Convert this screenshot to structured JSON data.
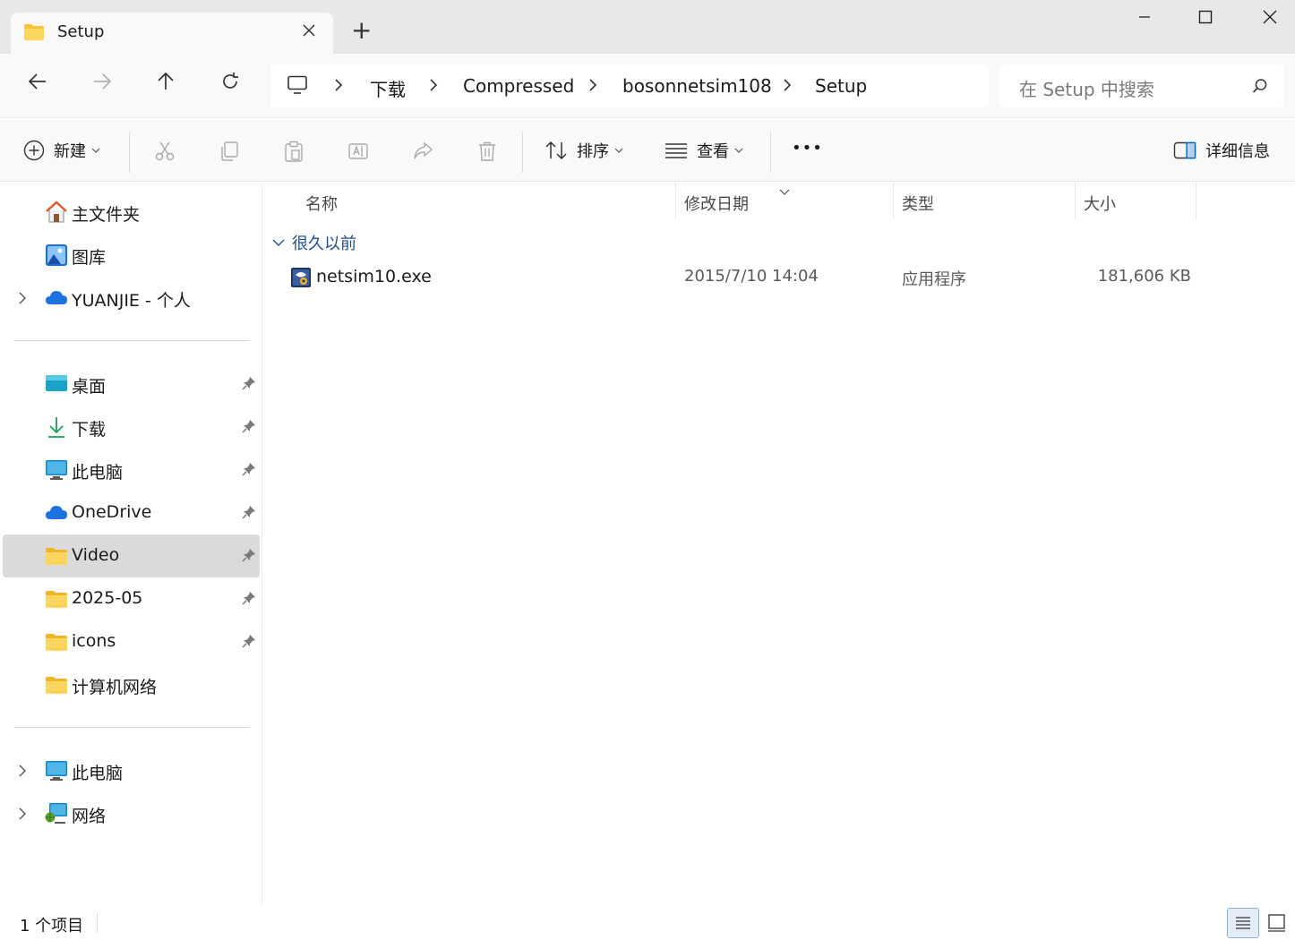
{
  "window": {
    "tab_title": "Setup",
    "new_tab": "+",
    "controls": {
      "minimize": "—",
      "maximize": "☐",
      "close": "✕"
    }
  },
  "address": {
    "crumbs": [
      "下载",
      "Compressed",
      "bosonnetsim108",
      "Setup"
    ],
    "search_placeholder": "在 Setup 中搜索"
  },
  "commandbar": {
    "new_label": "新建",
    "sort_label": "排序",
    "view_label": "查看",
    "more_label": "•••",
    "details_label": "详细信息"
  },
  "sidebar": {
    "quick": [
      {
        "label": "主文件夹",
        "icon": "home-icon"
      },
      {
        "label": "图库",
        "icon": "gallery-icon"
      },
      {
        "label": "YUANJIE - 个人",
        "icon": "cloud-icon"
      }
    ],
    "pinned": [
      {
        "label": "桌面",
        "icon": "desktop-icon"
      },
      {
        "label": "下载",
        "icon": "download-icon"
      },
      {
        "label": "此电脑",
        "icon": "computer-icon"
      },
      {
        "label": "OneDrive",
        "icon": "cloud-icon"
      },
      {
        "label": "Video",
        "icon": "folder-icon",
        "selected": true
      },
      {
        "label": "2025-05",
        "icon": "folder-icon"
      },
      {
        "label": "icons",
        "icon": "folder-icon"
      },
      {
        "label": "计算机网络",
        "icon": "folder-icon"
      }
    ],
    "bottom": [
      {
        "label": "此电脑",
        "icon": "computer-icon"
      },
      {
        "label": "网络",
        "icon": "network-icon"
      }
    ]
  },
  "columns": {
    "name": "名称",
    "date": "修改日期",
    "type": "类型",
    "size": "大小"
  },
  "group": {
    "label": "很久以前"
  },
  "files": [
    {
      "name": "netsim10.exe",
      "date": "2015/7/10 14:04",
      "type": "应用程序",
      "size": "181,606 KB"
    }
  ],
  "status": {
    "count": "1 个项目"
  },
  "colors": {
    "accent": "#0067c0",
    "folder": "#f8c53a",
    "selected": "#dadada",
    "group_text": "#1e4e8c"
  }
}
